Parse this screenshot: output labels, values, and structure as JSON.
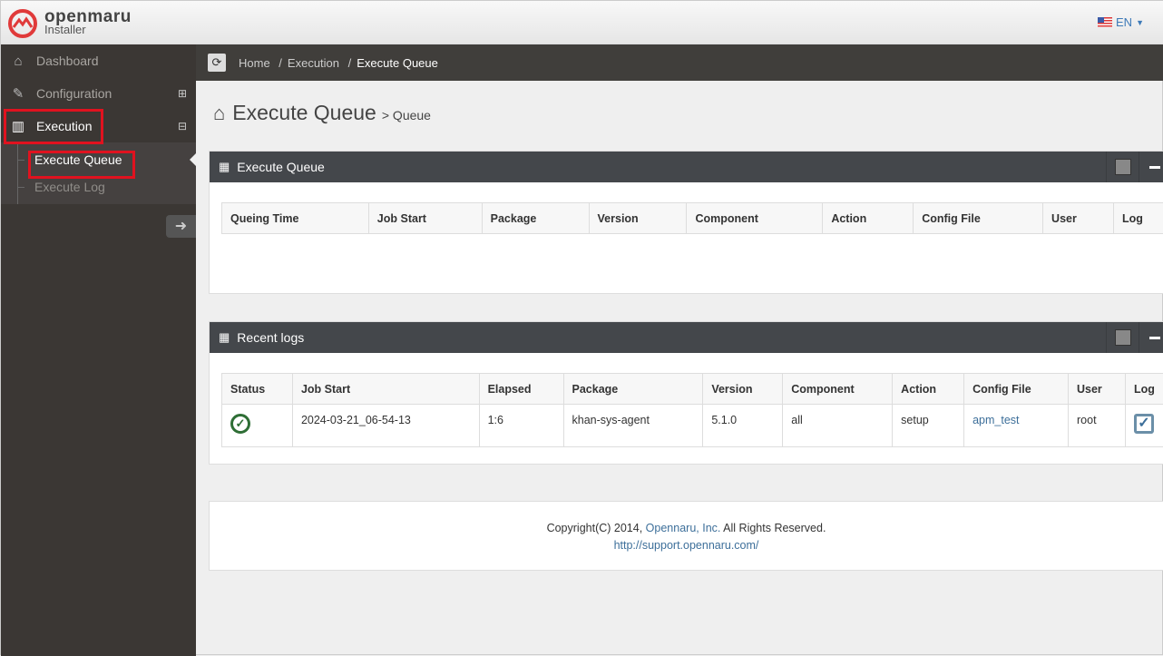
{
  "header": {
    "brand": "openmaru",
    "product": "Installer",
    "lang": "EN"
  },
  "sidebar": {
    "items": [
      {
        "label": "Dashboard",
        "icon": "home-icon"
      },
      {
        "label": "Configuration",
        "icon": "edit-icon",
        "toggle": "⊞"
      },
      {
        "label": "Execution",
        "icon": "bar-chart-icon",
        "toggle": "⊟"
      }
    ],
    "sub": [
      {
        "label": "Execute Queue"
      },
      {
        "label": "Execute Log"
      }
    ]
  },
  "breadcrumb": [
    "Home",
    "Execution",
    "Execute Queue"
  ],
  "page": {
    "title": "Execute Queue",
    "subtitle": "> Queue"
  },
  "queue": {
    "title": "Execute Queue",
    "columns": [
      "Queing Time",
      "Job Start",
      "Package",
      "Version",
      "Component",
      "Action",
      "Config File",
      "User",
      "Log"
    ]
  },
  "logs": {
    "title": "Recent logs",
    "columns": [
      "Status",
      "Job Start",
      "Elapsed",
      "Package",
      "Version",
      "Component",
      "Action",
      "Config File",
      "User",
      "Log"
    ],
    "rows": [
      {
        "status": "success",
        "job_start": "2024-03-21_06-54-13",
        "elapsed": "1:6",
        "package": "khan-sys-agent",
        "version": "5.1.0",
        "component": "all",
        "action": "setup",
        "config": "apm_test",
        "user": "root"
      }
    ]
  },
  "footer": {
    "copy": "Copyright(C) 2014,",
    "company": "Opennaru, Inc.",
    "rights": "All Rights Reserved.",
    "url": "http://support.opennaru.com/"
  }
}
